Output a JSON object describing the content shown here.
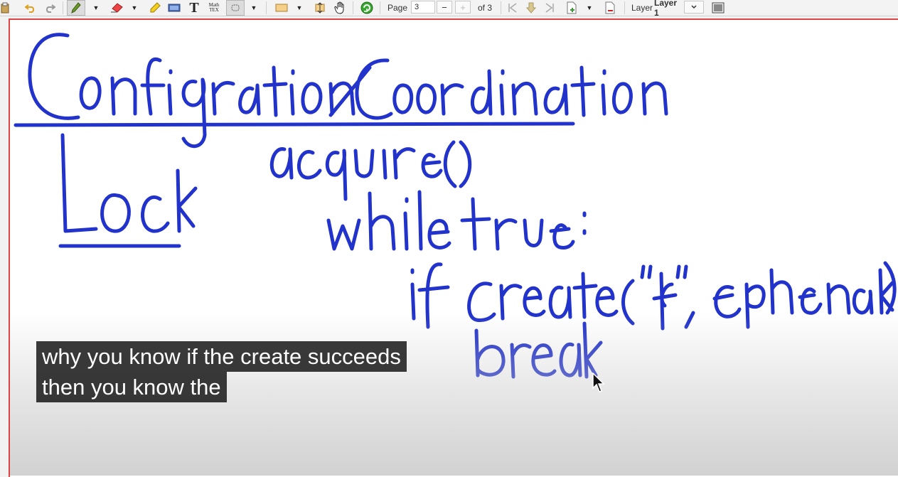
{
  "toolbar": {
    "page_label": "Page",
    "page_value": "3",
    "page_of": "of 3",
    "minus": "−",
    "plus": "+",
    "layer_label": "Layer",
    "layer_value": "Layer 1",
    "math_label_top": "Math",
    "math_label_bottom": "TEX",
    "text_tool": "T",
    "dropdown": "▼"
  },
  "caption": {
    "line1": "why you know if the create succeeds",
    "line2": "then you know the"
  },
  "colors": {
    "ink": "#2233cc",
    "page_border": "#dd4444",
    "caption_bg": "#181818"
  }
}
